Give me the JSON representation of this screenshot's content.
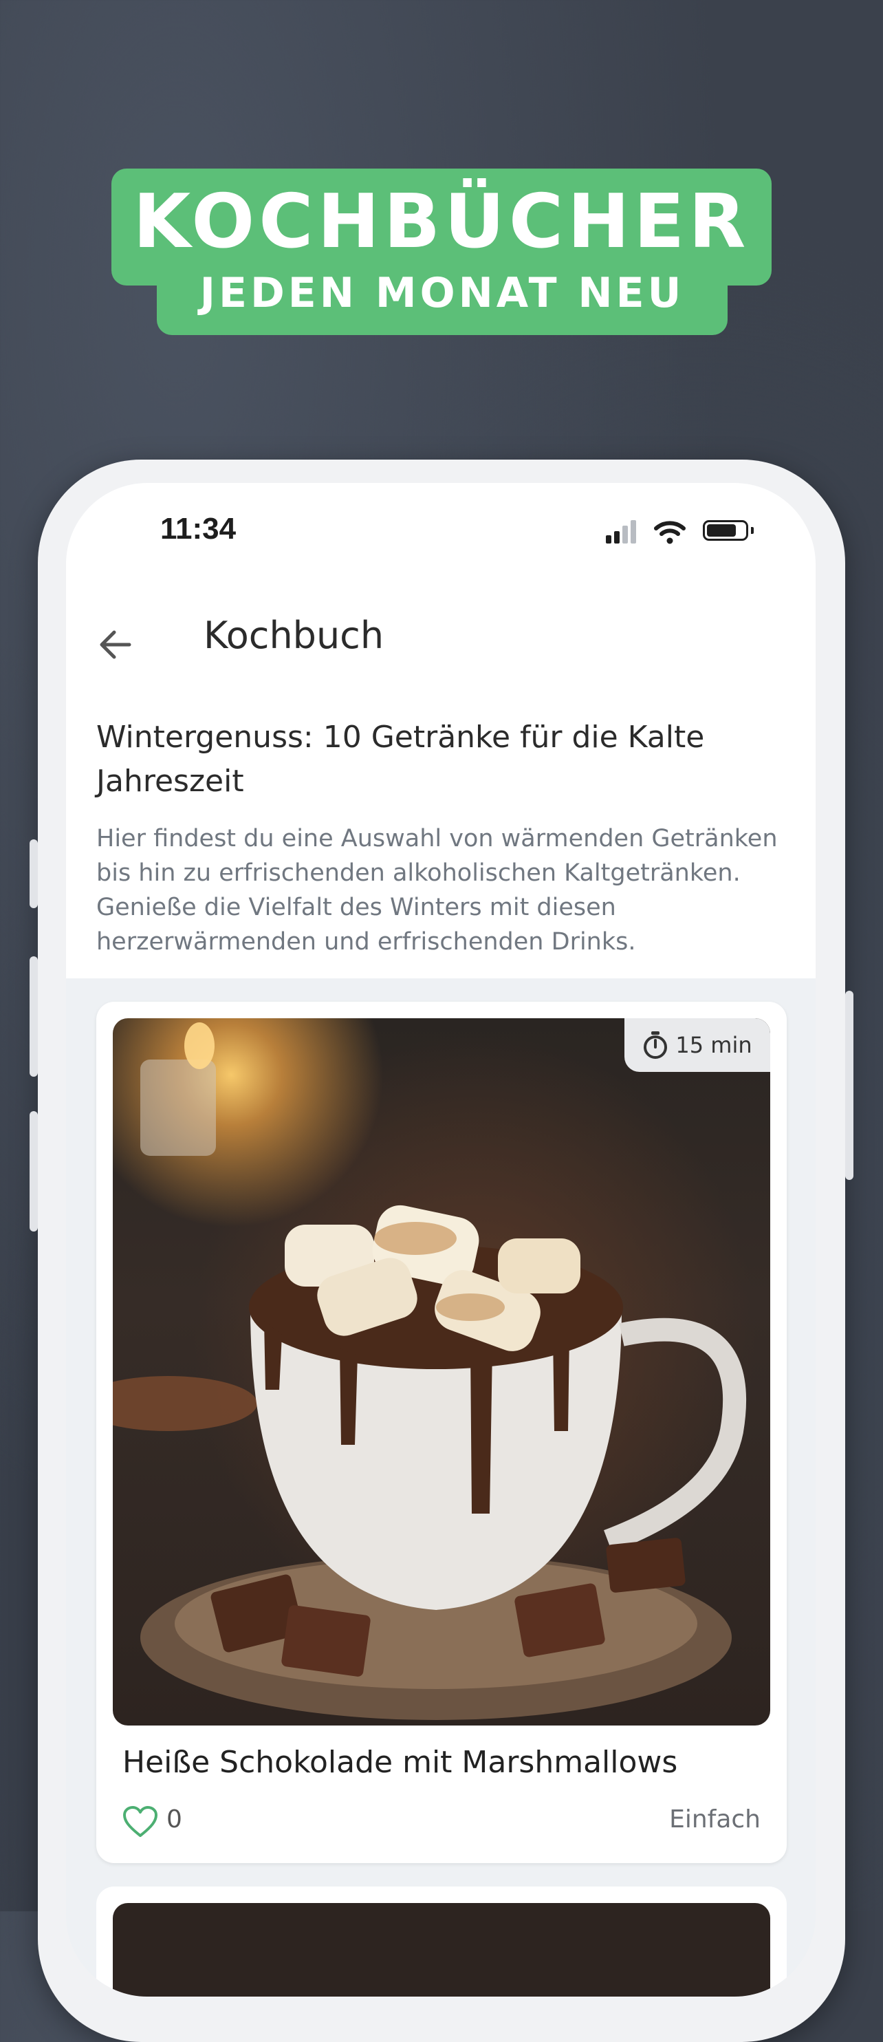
{
  "banner": {
    "title": "KOCHBÜCHER",
    "subtitle": "JEDEN MONAT NEU"
  },
  "status_bar": {
    "time": "11:34"
  },
  "nav": {
    "title": "Kochbuch",
    "back_icon": "arrow-left-icon"
  },
  "cookbook": {
    "title": "Wintergenuss: 10 Getränke für die Kalte Jahreszeit",
    "description": "Hier findest du eine Auswahl von wärmenden Getränken bis hin zu erfrischenden alkoholischen Kaltgetränken. Genieße die Vielfalt des Winters mit diesen herzerwärmenden und erfrischenden Drinks."
  },
  "recipes": [
    {
      "title": "Heiße Schokolade mit Marshmallows",
      "time": "15 min",
      "likes": "0",
      "difficulty": "Einfach"
    }
  ],
  "colors": {
    "accent_green": "#5cbf78",
    "heart_green": "#4caf72",
    "background": "#3b414c"
  }
}
